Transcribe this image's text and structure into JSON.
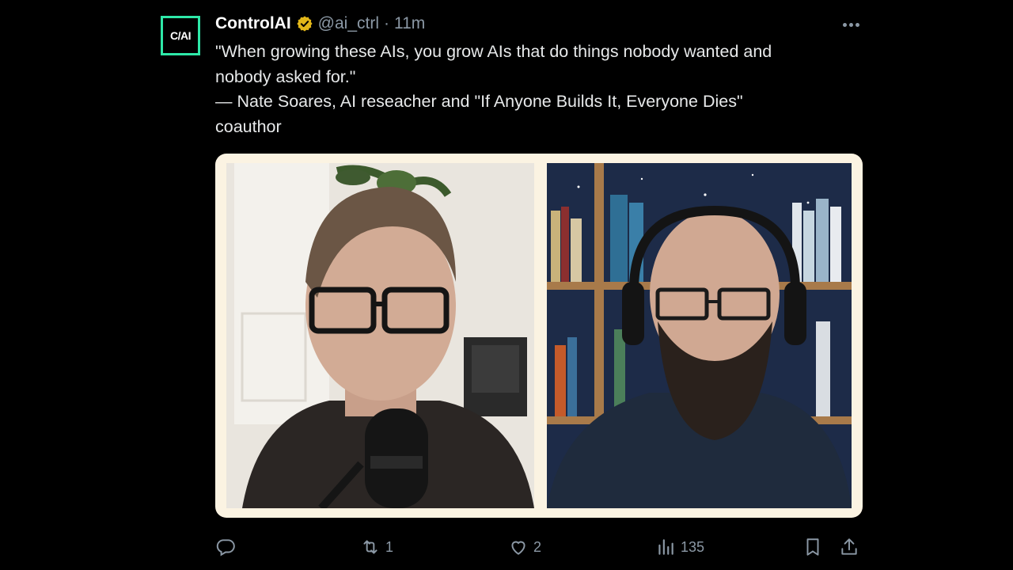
{
  "tweet": {
    "avatar_text": "C/AI",
    "name": "ControlAI",
    "handle": "@ai_ctrl",
    "separator": "·",
    "time": "11m",
    "lines": [
      "\"When growing these AIs, you grow AIs that do things nobody wanted and",
      "nobody asked for.\"",
      "— Nate Soares, AI reseacher and \"If Anyone Builds It, Everyone Dies\"",
      "coauthor"
    ]
  },
  "actions": {
    "reply_count": "",
    "retweet_count": "1",
    "like_count": "2",
    "views_count": "135"
  },
  "colors": {
    "background": "#000000",
    "text": "#e7e9ea",
    "muted": "#8b98a5",
    "verified_badge": "#e2b719",
    "avatar_border": "#2ee8a8",
    "media_frame": "#fbf3e2"
  },
  "icons": {
    "verified": "verified-badge-icon",
    "more": "more-icon",
    "reply": "reply-icon",
    "retweet": "retweet-icon",
    "like": "like-icon",
    "views": "views-icon",
    "bookmark": "bookmark-icon",
    "share": "share-icon"
  }
}
